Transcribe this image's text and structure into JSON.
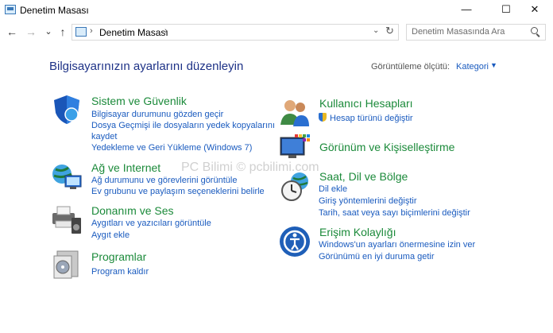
{
  "window": {
    "title": "Denetim Masası"
  },
  "window_controls": {
    "minimize": "—",
    "maximize": "☐",
    "close": "✕"
  },
  "nav": {
    "back": "←",
    "forward": "→",
    "recent": "⌄",
    "up": "↑"
  },
  "address": {
    "path": "Denetim Masası",
    "separator": "›",
    "dropdown": "⌄",
    "refresh": "↻"
  },
  "search": {
    "placeholder": "Denetim Masasında Ara"
  },
  "main": {
    "title": "Bilgisayarınızın ayarlarını düzenleyin",
    "view_by_label": "Görüntüleme ölçütü:",
    "view_by_value": "Kategori",
    "view_by_caret": "▼"
  },
  "categories_left": [
    {
      "title": "Sistem ve Güvenlik",
      "icon": "security-shield-icon",
      "links": [
        "Bilgisayar durumunu gözden geçir",
        "Dosya Geçmişi ile dosyaların yedek kopyalarını",
        "kaydet",
        "Yedekleme ve Geri Yükleme (Windows 7)"
      ]
    },
    {
      "title": "Ağ ve Internet",
      "icon": "network-globe-icon",
      "links": [
        "Ağ durumunu ve görevlerini görüntüle",
        "Ev grubunu ve paylaşım seçeneklerini belirle"
      ]
    },
    {
      "title": "Donanım ve Ses",
      "icon": "printer-speaker-icon",
      "links": [
        "Aygıtları ve yazıcıları görüntüle",
        "Aygıt ekle"
      ]
    },
    {
      "title": "Programlar",
      "icon": "programs-disc-icon",
      "links": [
        "Program kaldır"
      ]
    }
  ],
  "categories_right": [
    {
      "title": "Kullanıcı Hesapları",
      "icon": "users-icon",
      "links": [
        "Hesap türünü değiştir"
      ]
    },
    {
      "title": "Görünüm ve Kişiselleştirme",
      "icon": "display-palette-icon",
      "links": []
    },
    {
      "title": "Saat, Dil ve Bölge",
      "icon": "clock-globe-icon",
      "links": [
        "Dil ekle",
        "Giriş yöntemlerini değiştir",
        "Tarih, saat veya sayı biçimlerini değiştir"
      ]
    },
    {
      "title": "Erişim Kolaylığı",
      "icon": "ease-of-access-icon",
      "links": [
        "Windows'un ayarları önermesine izin ver",
        "Görünümü en iyi duruma getir"
      ]
    }
  ],
  "watermark": "PC Bilimi © pcbilimi.com"
}
